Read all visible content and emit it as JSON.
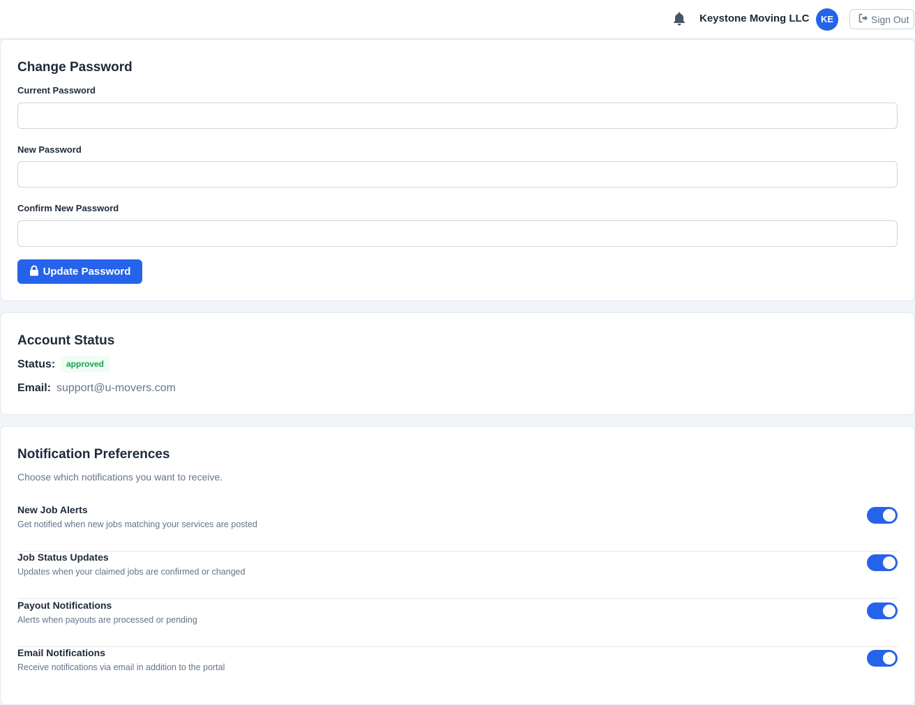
{
  "header": {
    "company": "Keystone Moving LLC",
    "avatar_initials": "KE",
    "sign_out_label": "Sign Out"
  },
  "change_password": {
    "title": "Change Password",
    "current_label": "Current Password",
    "current_value": "",
    "new_label": "New Password",
    "new_value": "",
    "confirm_label": "Confirm New Password",
    "confirm_value": "",
    "button_label": "Update Password"
  },
  "account_status": {
    "title": "Account Status",
    "status_label": "Status:",
    "status_value": "approved",
    "email_label": "Email:",
    "email_value": "support@u-movers.com"
  },
  "notifications": {
    "title": "Notification Preferences",
    "subtitle": "Choose which notifications you want to receive.",
    "items": [
      {
        "title": "New Job Alerts",
        "description": "Get notified when new jobs matching your services are posted",
        "enabled": true
      },
      {
        "title": "Job Status Updates",
        "description": "Updates when your claimed jobs are confirmed or changed",
        "enabled": true
      },
      {
        "title": "Payout Notifications",
        "description": "Alerts when payouts are processed or pending",
        "enabled": true
      },
      {
        "title": "Email Notifications",
        "description": "Receive notifications via email in addition to the portal",
        "enabled": true
      }
    ]
  },
  "icons": {
    "bell": "bell-icon",
    "sign_out": "sign-out-icon",
    "lock": "lock-icon"
  },
  "colors": {
    "primary": "#2563eb",
    "status_green": "#16a34a",
    "status_green_bg": "#f0fdf4",
    "muted_text": "#64748b"
  }
}
